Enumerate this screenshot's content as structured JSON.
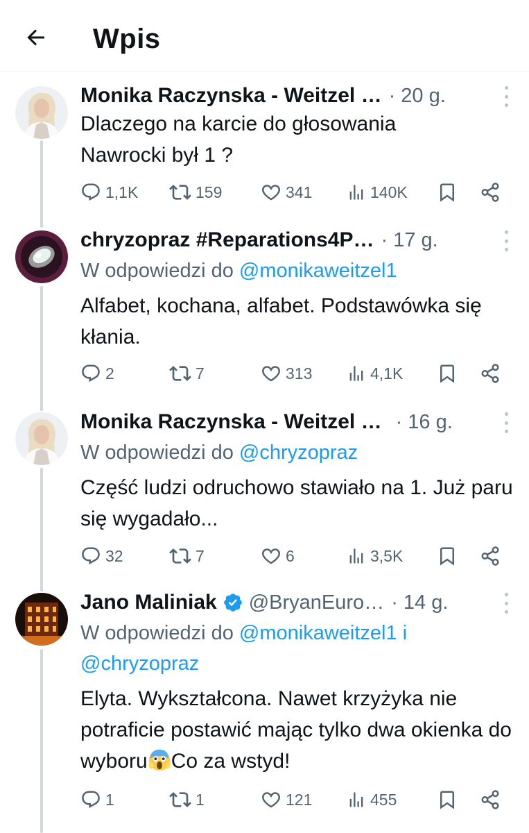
{
  "header": {
    "title": "Wpis",
    "back_icon": "arrow-left-icon"
  },
  "colors": {
    "link": "#1d9bf0",
    "muted": "#536471",
    "text": "#0f1419",
    "thread_line": "#cfd9de"
  },
  "tweets": [
    {
      "name": "Monika Raczynska - Weitzel …",
      "time": "· 20 g.",
      "text": "Dlaczego na karcie do głosowania Nawrocki był 1 ?",
      "stats": {
        "replies": "1,1K",
        "reposts": "159",
        "likes": "341",
        "views": "140K"
      }
    },
    {
      "name": "chryzopraz #Reparations4P…",
      "time": "· 17 g.",
      "reply_prefix": "W odpowiedzi do ",
      "reply_mentions": "@monikaweitzel1",
      "text": "Alfabet, kochana, alfabet. Podstawówka się kłania.",
      "stats": {
        "replies": "2",
        "reposts": "7",
        "likes": "313",
        "views": "4,1K"
      }
    },
    {
      "name": "Monika Raczynska - Weitzel …",
      "time": "· 16 g.",
      "reply_prefix": "W odpowiedzi do ",
      "reply_mentions": "@chryzopraz",
      "text": "Część ludzi odruchowo stawiało na 1. Już paru się wygadało...",
      "stats": {
        "replies": "32",
        "reposts": "7",
        "likes": "6",
        "views": "3,5K"
      }
    },
    {
      "name": "Jano Maliniak",
      "handle": "@BryanEuro…",
      "time": "· 14 g.",
      "reply_prefix": "W odpowiedzi do ",
      "reply_mentions": "@monikaweitzel1 i",
      "reply_mentions_2": "@chryzopraz",
      "text_before_emoji": "Elyta. Wykształcona. Nawet krzyżyka nie potraficie postawić mając tylko dwa okienka do wyboru",
      "text_after_emoji": "Co za wstyd!",
      "emoji": "screaming-face-emoji",
      "stats": {
        "replies": "1",
        "reposts": "1",
        "likes": "121",
        "views": "455"
      }
    }
  ]
}
